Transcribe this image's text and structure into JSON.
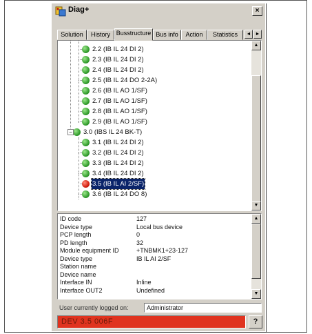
{
  "window": {
    "title": "Diag+",
    "close_label": "×"
  },
  "tabs": [
    {
      "label": "Solution",
      "active": false
    },
    {
      "label": "History",
      "active": false
    },
    {
      "label": "Busstructure",
      "active": true
    },
    {
      "label": "Bus info",
      "active": false
    },
    {
      "label": "Action",
      "active": false
    },
    {
      "label": "Statistics",
      "active": false
    }
  ],
  "tab_scroll": {
    "left": "◄",
    "right": "►"
  },
  "tree": [
    {
      "label": "2.2 (IB IL 24 DI 2)",
      "status": "ok",
      "level": 2
    },
    {
      "label": "2.3 (IB IL 24 DI 2)",
      "status": "ok",
      "level": 2
    },
    {
      "label": "2.4 (IB IL 24 DI 2)",
      "status": "ok",
      "level": 2
    },
    {
      "label": "2.5 (IB IL 24 DO 2-2A)",
      "status": "ok",
      "level": 2
    },
    {
      "label": "2.6 (IB IL AO 1/SF)",
      "status": "ok",
      "level": 2
    },
    {
      "label": "2.7 (IB IL AO 1/SF)",
      "status": "ok",
      "level": 2
    },
    {
      "label": "2.8 (IB IL AO 1/SF)",
      "status": "ok",
      "level": 2
    },
    {
      "label": "2.9 (IB IL AO 1/SF)",
      "status": "ok",
      "level": 2
    },
    {
      "label": "3.0 (IBS IL 24 BK-T)",
      "status": "ok",
      "level": 1,
      "expander": "−"
    },
    {
      "label": "3.1 (IB IL 24 DI 2)",
      "status": "ok",
      "level": 2
    },
    {
      "label": "3.2 (IB IL 24 DI 2)",
      "status": "ok",
      "level": 2
    },
    {
      "label": "3.3 (IB IL 24 DI 2)",
      "status": "ok",
      "level": 2
    },
    {
      "label": "3.4 (IB IL 24 DI 2)",
      "status": "ok",
      "level": 2
    },
    {
      "label": "3.5 (IB IL AI 2/SF)",
      "status": "error",
      "level": 2,
      "selected": true
    },
    {
      "label": "3.6 (IB IL 24 DO 8)",
      "status": "ok",
      "level": 2
    }
  ],
  "info": [
    {
      "key": "ID code",
      "value": "127"
    },
    {
      "key": "Device type",
      "value": "Local bus device"
    },
    {
      "key": "PCP length",
      "value": "0"
    },
    {
      "key": "PD length",
      "value": "32"
    },
    {
      "key": "Module equipment ID",
      "value": "+TNBMK1+23-127"
    },
    {
      "key": "Device type",
      "value": "IB IL AI 2/SF"
    },
    {
      "key": "Station name",
      "value": ""
    },
    {
      "key": "Device name",
      "value": ""
    },
    {
      "key": "Interface IN",
      "value": "Inline"
    },
    {
      "key": "Interface OUT2",
      "value": "Undefined"
    }
  ],
  "login": {
    "label": "User currently logged on:",
    "value": "Administrator"
  },
  "status": {
    "text": "DEV 3.5 006F",
    "color": "#e0331f"
  },
  "help_label": "?",
  "scroll": {
    "up": "▲",
    "down": "▼"
  }
}
